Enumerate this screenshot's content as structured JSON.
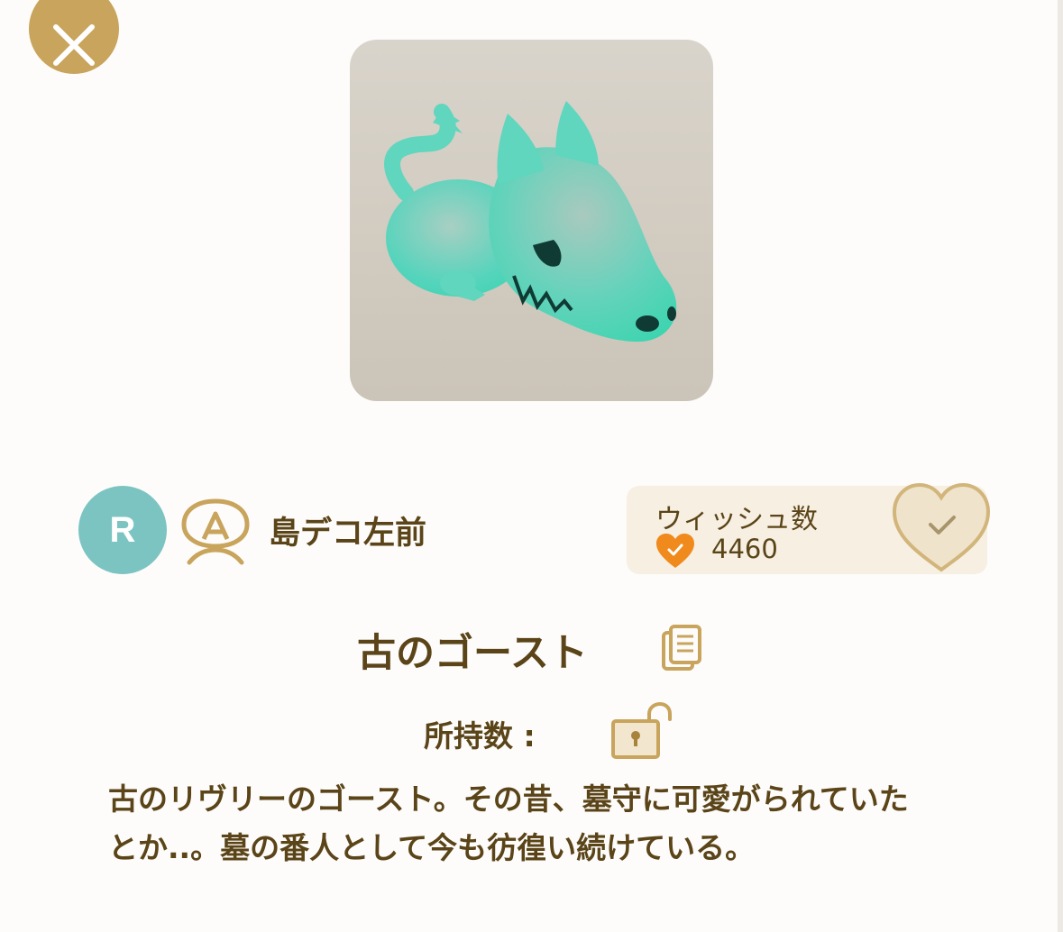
{
  "creator": {
    "avatar_letter": "R",
    "name": "島デコ左前"
  },
  "wish": {
    "label": "ウィッシュ数",
    "count": "4460"
  },
  "item": {
    "title": "古のゴースト",
    "owned_label": "所持数 :",
    "description": "古のリヴリーのゴースト。その昔、墓守に可愛がられていたとか..。墓の番人として今も彷徨い続けている。"
  },
  "icons": {
    "close": "close-icon",
    "badge": "creator-badge-icon",
    "wish_small": "heart-check-icon",
    "wish_button": "heart-check-outline-icon",
    "copy": "copy-icon",
    "lock": "unlocked-padlock-icon"
  },
  "colors": {
    "accent_gold": "#c8a45c",
    "text_brown": "#5a4418",
    "avatar_teal": "#7cc4c2",
    "wish_orange": "#f08a1c",
    "card_bg": "#f6efe2"
  }
}
